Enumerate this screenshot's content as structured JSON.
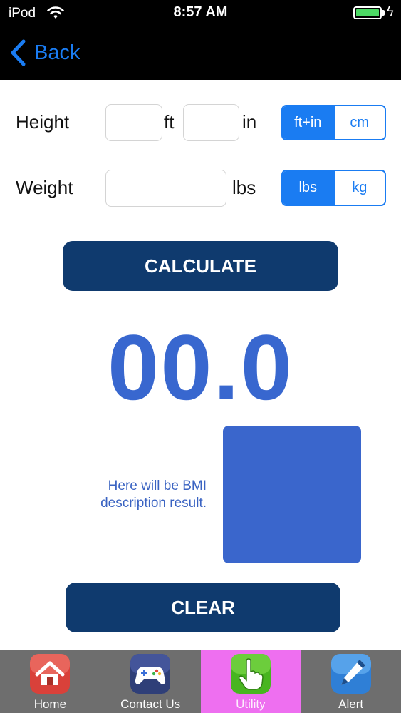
{
  "status_bar": {
    "carrier": "iPod",
    "time": "8:57 AM",
    "battery_level": 1.0
  },
  "nav": {
    "back_label": "Back"
  },
  "height_row": {
    "label": "Height",
    "feet_value": "",
    "feet_unit": "ft",
    "inches_value": "",
    "inches_unit": "in",
    "units": {
      "options": [
        "ft+in",
        "cm"
      ],
      "selected": "ft+in"
    }
  },
  "weight_row": {
    "label": "Weight",
    "value": "",
    "unit": "lbs",
    "units": {
      "options": [
        "lbs",
        "kg"
      ],
      "selected": "lbs"
    }
  },
  "calculate_label": "CALCULATE",
  "result": {
    "bmi_value": "00.0",
    "description": "Here will be BMI description result.",
    "category_color": "#3a66cc"
  },
  "clear_label": "CLEAR",
  "tab_bar": {
    "selected": "Utility",
    "tabs": [
      {
        "label": "Home",
        "icon": "home-icon"
      },
      {
        "label": "Contact Us",
        "icon": "gamepad-icon"
      },
      {
        "label": "Utility",
        "icon": "hand-pointer-icon"
      },
      {
        "label": "Alert",
        "icon": "pen-icon"
      }
    ]
  },
  "colors": {
    "accent": "#1a7cf2",
    "button": "#0f3a6e",
    "result": "#3867cf",
    "selected_tab": "#ee6ff0"
  }
}
